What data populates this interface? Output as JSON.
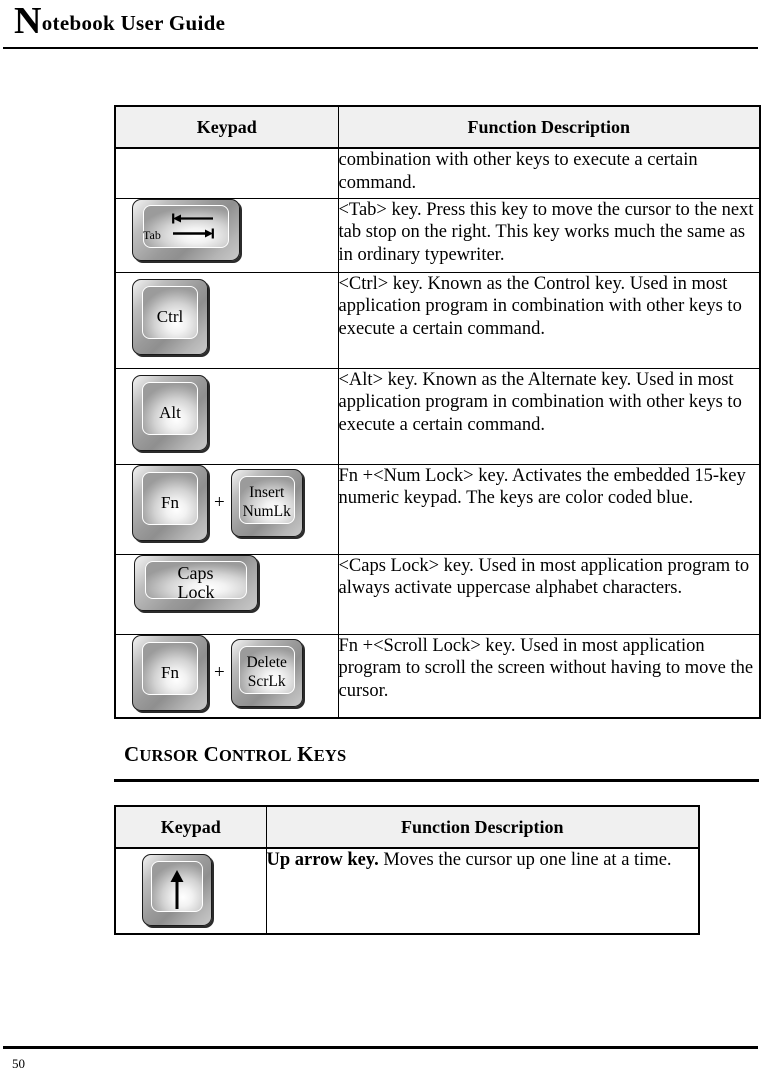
{
  "header": {
    "title_dropcap": "N",
    "title_rest": "otebook User Guide"
  },
  "tables": {
    "modifier_keys": {
      "columns": [
        "Keypad",
        "Function Description"
      ],
      "rows": [
        {
          "keys": [],
          "description": "combination with other keys to execute a certain command."
        },
        {
          "keys": [
            {
              "type": "tab",
              "legend": "Tab"
            }
          ],
          "description": "<Tab> key. Press this key to move the cursor to the next tab stop on the right. This key works much the same as in ordinary typewriter."
        },
        {
          "keys": [
            {
              "type": "square",
              "legend": "Ctrl"
            }
          ],
          "description": "<Ctrl> key. Known as the Control key. Used in most application program in combination with other keys to execute a certain command."
        },
        {
          "keys": [
            {
              "type": "square",
              "legend": "Alt"
            }
          ],
          "description": "<Alt> key. Known as the Alternate key. Used in most application program in combination with other keys to execute a certain command."
        },
        {
          "keys": [
            {
              "type": "square",
              "legend": "Fn"
            },
            {
              "type": "plus",
              "legend": "+"
            },
            {
              "type": "square-sm",
              "legend": "Insert",
              "legend2": "NumLk"
            }
          ],
          "description": "Fn +<Num Lock> key. Activates the embedded 15-key numeric keypad. The keys are color coded blue."
        },
        {
          "keys": [
            {
              "type": "wide-caps",
              "legend": "Caps",
              "legend2": "Lock"
            }
          ],
          "description": "<Caps Lock> key. Used in most application program to always activate uppercase alphabet characters."
        },
        {
          "keys": [
            {
              "type": "square",
              "legend": "Fn"
            },
            {
              "type": "plus",
              "legend": "+"
            },
            {
              "type": "square-sm",
              "legend": "Delete",
              "legend2": "ScrLk"
            }
          ],
          "description": "Fn +<Scroll Lock> key. Used in most application program to scroll the screen without having to move the cursor."
        }
      ]
    },
    "cursor_keys": {
      "columns": [
        "Keypad",
        "Function Description"
      ],
      "rows": [
        {
          "keys": [
            {
              "type": "arrow-up",
              "legend": ""
            }
          ],
          "description_bold": "Up arrow key.",
          "description": " Moves the cursor up one line at a time."
        }
      ]
    }
  },
  "section_heading": {
    "word1_first": "C",
    "word1_rest": "URSOR",
    "word2_first": "C",
    "word2_rest": "ONTROL",
    "word3_first": "K",
    "word3_rest": "EYS"
  },
  "footer": {
    "page_number": "50"
  }
}
